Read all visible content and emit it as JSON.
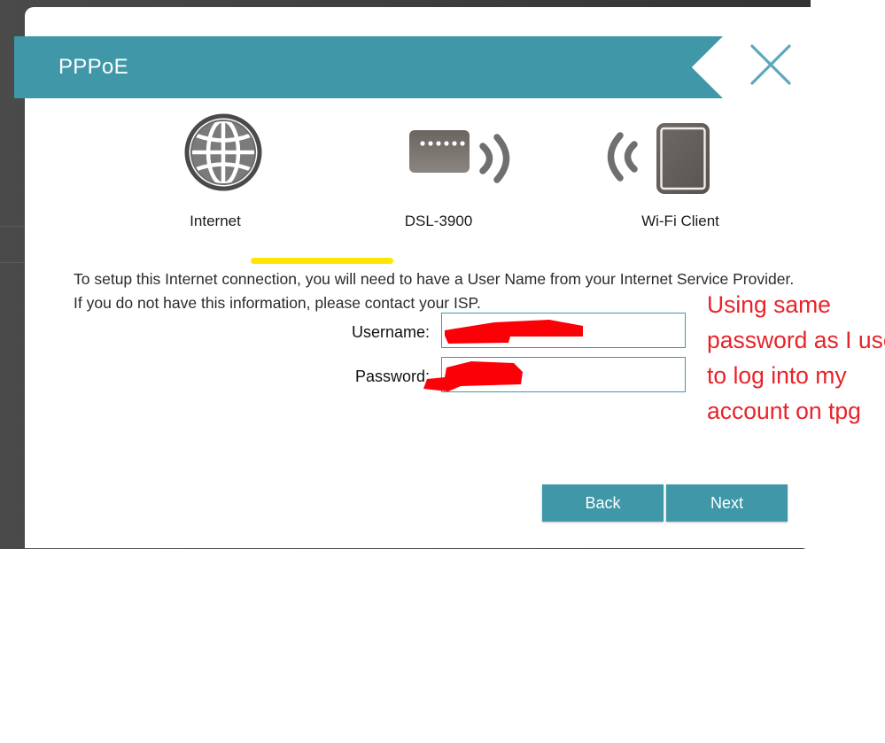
{
  "modal": {
    "title": "PPPoE",
    "close_icon": "close-icon"
  },
  "diagram": {
    "nodes": [
      {
        "icon": "globe-icon",
        "label": "Internet"
      },
      {
        "icon": "router-icon",
        "label": "DSL-3900"
      },
      {
        "icon": "tablet-icon",
        "label": "Wi-Fi Client"
      }
    ],
    "link_color": "#ffe800"
  },
  "content": {
    "intro": "To setup this Internet connection, you will need to have a User Name from your Internet Service Provider. If you do not have this information, please contact your ISP."
  },
  "form": {
    "username_label": "Username:",
    "username_value": "",
    "username_placeholder": "",
    "password_label": "Password:",
    "password_value": "",
    "password_placeholder": ""
  },
  "annotation": {
    "text": "Using same password as I use to log into my account on tpg",
    "color": "#e8232a"
  },
  "buttons": {
    "back_label": "Back",
    "next_label": "Next"
  },
  "colors": {
    "accent_teal": "#3f97a8",
    "redaction_red": "#fb0007",
    "backdrop_gray": "#3d3d3d"
  }
}
